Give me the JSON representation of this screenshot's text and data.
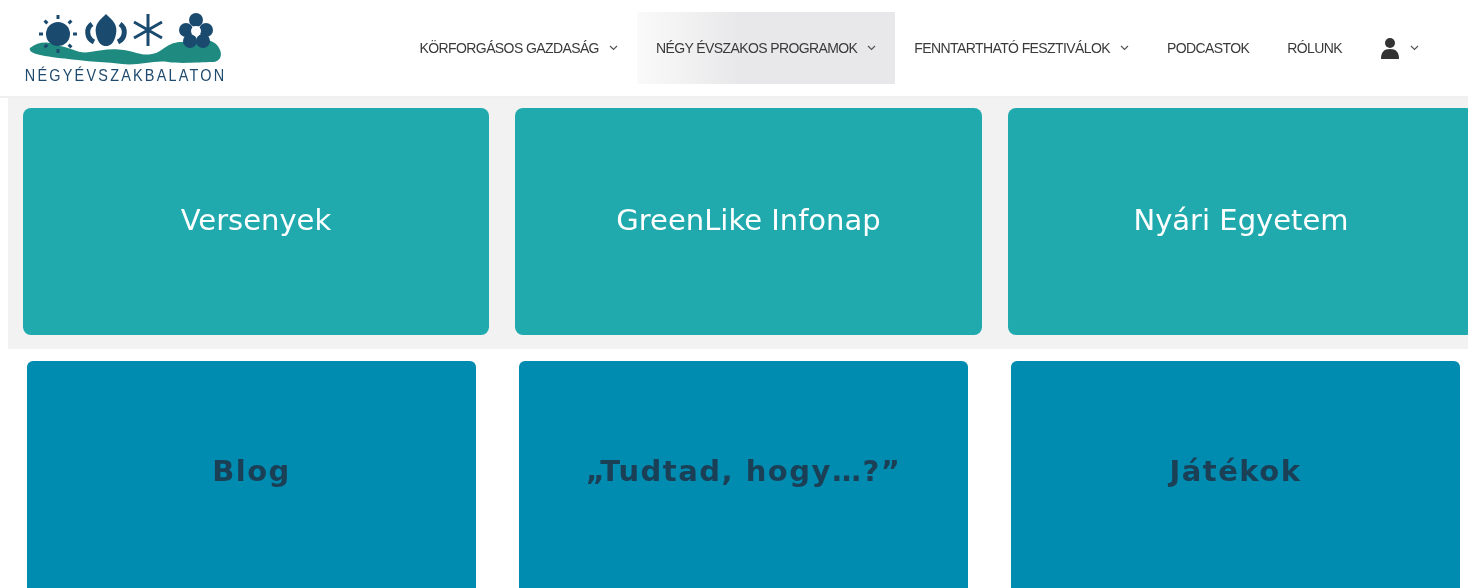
{
  "logo": {
    "text": "NÉGYÉVSZAKBALATON"
  },
  "menu": [
    {
      "kind": "text",
      "label": "KÖRFORGÁSOS GAZDASÁG",
      "dropdown": true,
      "selected": false
    },
    {
      "kind": "text",
      "label": "NÉGY ÉVSZAKOS PROGRAMOK",
      "dropdown": true,
      "selected": true
    },
    {
      "kind": "text",
      "label": "FENNTARTHATÓ FESZTIVÁLOK",
      "dropdown": true,
      "selected": false
    },
    {
      "kind": "text",
      "label": "PODCASTOK",
      "dropdown": false,
      "selected": false
    },
    {
      "kind": "text",
      "label": "RÓLUNK",
      "dropdown": false,
      "selected": false
    },
    {
      "kind": "account",
      "dropdown": true,
      "selected": false
    }
  ],
  "sections": [
    {
      "kind": "teal",
      "tiles": [
        {
          "label": "Versenyek"
        },
        {
          "label": "GreenLike Infonap"
        },
        {
          "label": "Nyári Egyetem"
        }
      ]
    },
    {
      "kind": "blue",
      "tiles": [
        {
          "label": "Blog"
        },
        {
          "label": "„Tudtad, hogy…?”"
        },
        {
          "label": "Játékok"
        }
      ]
    }
  ]
}
